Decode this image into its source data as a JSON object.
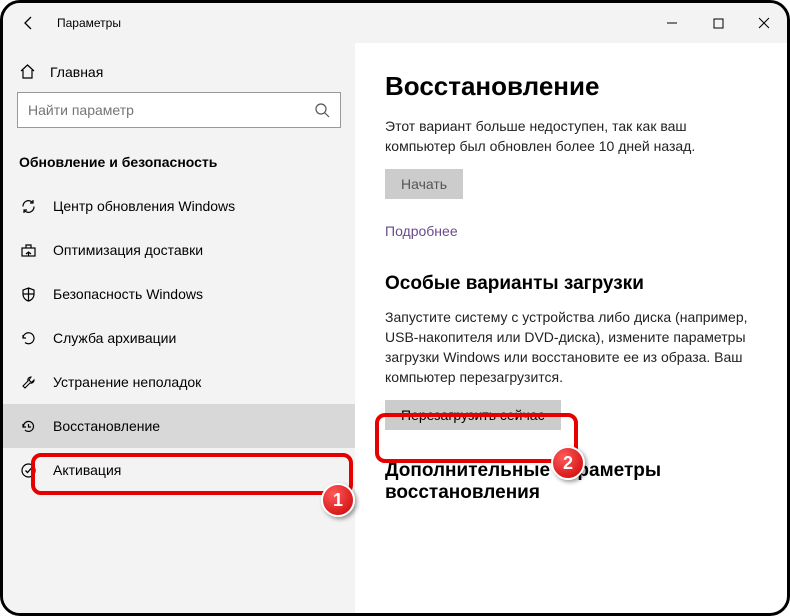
{
  "titlebar": {
    "title": "Параметры"
  },
  "sidebar": {
    "home_label": "Главная",
    "search_placeholder": "Найти параметр",
    "section_title": "Обновление и безопасность",
    "items": [
      {
        "label": "Центр обновления Windows"
      },
      {
        "label": "Оптимизация доставки"
      },
      {
        "label": "Безопасность Windows"
      },
      {
        "label": "Служба архивации"
      },
      {
        "label": "Устранение неполадок"
      },
      {
        "label": "Восстановление"
      },
      {
        "label": "Активация"
      }
    ]
  },
  "main": {
    "page_title": "Восстановление",
    "desc1": "Этот вариант больше недоступен, так как ваш компьютер был обновлен более 10 дней назад.",
    "start_btn": "Начать",
    "more_link": "Подробнее",
    "section2_title": "Особые варианты загрузки",
    "desc2": "Запустите систему с устройства либо диска (например, USB-накопителя или DVD-диска), измените параметры загрузки Windows или восстановите ее из образа. Ваш компьютер перезагрузится.",
    "restart_btn": "Перезагрузить сейчас",
    "section3_title": "Дополнительные параметры восстановления"
  },
  "badges": {
    "b1": "1",
    "b2": "2"
  }
}
